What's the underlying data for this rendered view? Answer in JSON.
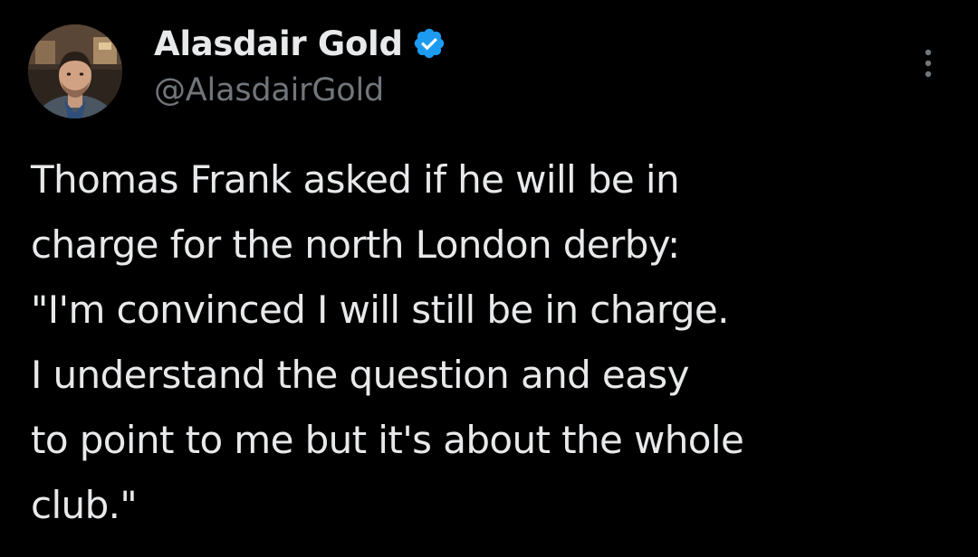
{
  "post": {
    "author": {
      "display_name": "Alasdair Gold",
      "handle": "@AlasdairGold",
      "verified": true,
      "verified_badge_color": "#1d9bf0"
    },
    "text_lines": [
      "Thomas Frank asked if he will be in",
      "charge for the north London derby:",
      "\"I'm convinced I will still be in charge.",
      "I understand the question and easy",
      "to point to me but it's about the whole",
      "club.\""
    ],
    "more_menu_icon": "more-vertical-icon"
  },
  "theme": {
    "background": "#000000",
    "primary_text": "#e7e9ea",
    "secondary_text": "#71767b"
  }
}
